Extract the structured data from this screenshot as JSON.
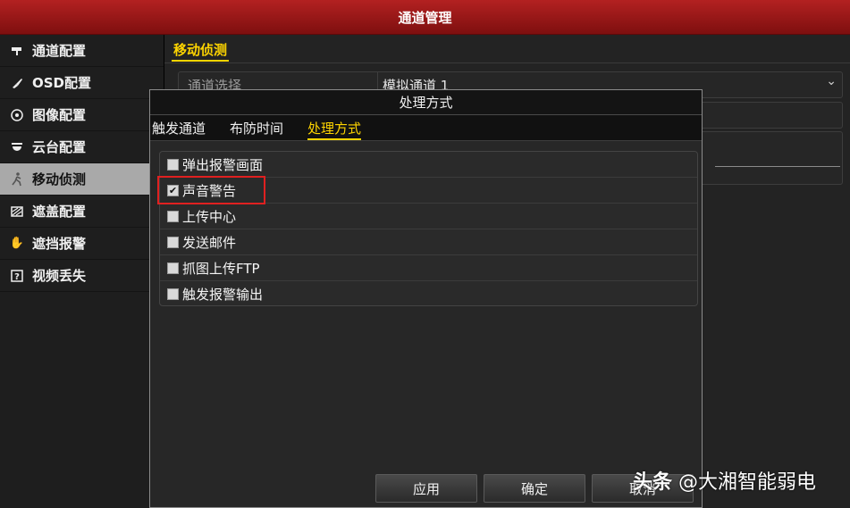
{
  "window": {
    "title": "通道管理"
  },
  "sidebar": {
    "items": [
      {
        "label": "通道配置",
        "icon": "camera-icon",
        "active": false
      },
      {
        "label": "OSD配置",
        "icon": "brush-icon",
        "active": false
      },
      {
        "label": "图像配置",
        "icon": "aperture-icon",
        "active": false
      },
      {
        "label": "云台配置",
        "icon": "ptz-icon",
        "active": false
      },
      {
        "label": "移动侦测",
        "icon": "running-person-icon",
        "active": true
      },
      {
        "label": "遮盖配置",
        "icon": "mask-icon",
        "active": false
      },
      {
        "label": "遮挡报警",
        "icon": "hand-icon",
        "active": false
      },
      {
        "label": "视频丢失",
        "icon": "question-box-icon",
        "active": false
      }
    ]
  },
  "main": {
    "section_tab": "移动侦测",
    "channel_label": "通道选择",
    "channel_value": "模拟通道 1"
  },
  "dialog": {
    "title": "处理方式",
    "tabs": [
      {
        "label": "触发通道",
        "active": false
      },
      {
        "label": "布防时间",
        "active": false
      },
      {
        "label": "处理方式",
        "active": true
      }
    ],
    "options": [
      {
        "label": "弹出报警画面",
        "checked": false
      },
      {
        "label": "声音警告",
        "checked": true
      },
      {
        "label": "上传中心",
        "checked": false
      },
      {
        "label": "发送邮件",
        "checked": false
      },
      {
        "label": "抓图上传FTP",
        "checked": false
      },
      {
        "label": "触发报警输出",
        "checked": false
      }
    ],
    "buttons": {
      "apply": "应用",
      "ok": "确定",
      "cancel": "取消"
    }
  },
  "watermark": {
    "brand": "头条",
    "handle": "@大湘智能弱电"
  },
  "colors": {
    "titlebar": "#a51a1a",
    "accent": "#ffd500",
    "highlight": "#e02020"
  }
}
